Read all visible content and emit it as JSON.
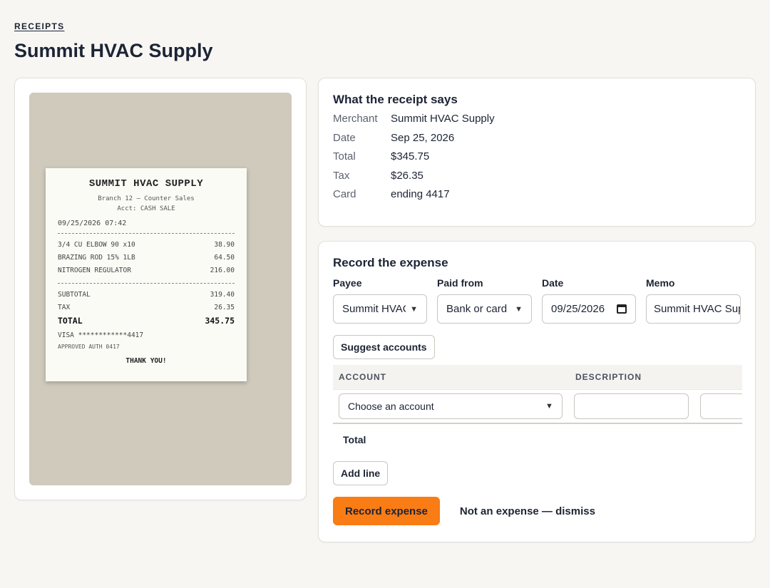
{
  "breadcrumb": "RECEIPTS",
  "page_title": "Summit HVAC Supply",
  "receipt": {
    "title": "SUMMIT HVAC SUPPLY",
    "branch": "Branch 12 – Counter Sales",
    "acct": "Acct: CASH SALE",
    "datetime": "09/25/2026 07:42",
    "items": [
      {
        "name": "3/4 CU ELBOW 90 x10",
        "amount": "38.90"
      },
      {
        "name": "BRAZING ROD 15% 1LB",
        "amount": "64.50"
      },
      {
        "name": "NITROGEN REGULATOR",
        "amount": "216.00"
      }
    ],
    "subtotal_label": "SUBTOTAL",
    "subtotal": "319.40",
    "tax_label": "TAX",
    "tax": "26.35",
    "total_label": "TOTAL",
    "total": "345.75",
    "visa": "VISA ************4417",
    "auth": "APPROVED AUTH 0417",
    "thanks": "THANK YOU!"
  },
  "says": {
    "title": "What the receipt says",
    "rows": [
      {
        "label": "Merchant",
        "value": "Summit HVAC Supply"
      },
      {
        "label": "Date",
        "value": "Sep 25, 2026"
      },
      {
        "label": "Total",
        "value": "$345.75"
      },
      {
        "label": "Tax",
        "value": "$26.35"
      },
      {
        "label": "Card",
        "value": "ending 4417"
      }
    ]
  },
  "record": {
    "title": "Record the expense",
    "payee_label": "Payee",
    "payee_value": "Summit HVAC Supply",
    "paid_from_label": "Paid from",
    "paid_from_value": "Bank or card",
    "date_label": "Date",
    "date_value": "09/25/2026",
    "memo_label": "Memo",
    "memo_value": "Summit HVAC Supply",
    "suggest_label": "Suggest accounts",
    "col_account": "ACCOUNT",
    "col_description": "DESCRIPTION",
    "account_placeholder": "Choose an account",
    "total_label": "Total",
    "add_line_label": "Add line",
    "record_label": "Record expense",
    "dismiss_label": "Not an expense — dismiss"
  },
  "colors": {
    "primary": "#f97c14",
    "background": "#f7f6f3",
    "receipt_backdrop": "#cfcabc"
  }
}
